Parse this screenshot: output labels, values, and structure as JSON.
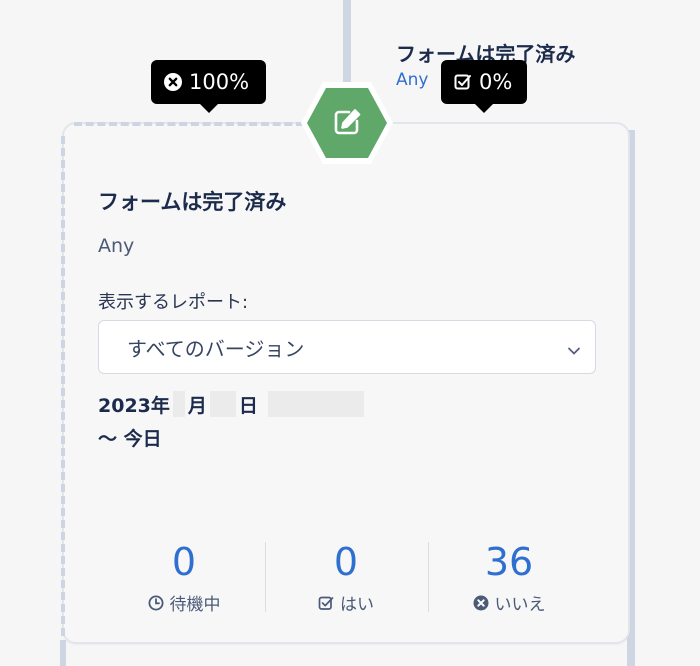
{
  "branch": {
    "title": "フォームは完了済み",
    "subtitle": "Any"
  },
  "tooltips": [
    {
      "icon": "x-circle-icon",
      "text": "100%"
    },
    {
      "icon": "checkbox-icon",
      "text": "0%"
    }
  ],
  "card": {
    "icon": "edit-icon",
    "title": "フォームは完了済み",
    "subtitle": "Any",
    "report_label": "表示するレポート:",
    "version_select": "すべてのバージョン",
    "date": {
      "year": "2023年",
      "month": "月",
      "day": "日",
      "until": "～ 今日"
    }
  },
  "stats": [
    {
      "value": "0",
      "label": "待機中",
      "icon": "clock-icon"
    },
    {
      "value": "0",
      "label": "はい",
      "icon": "checkbox-icon"
    },
    {
      "value": "36",
      "label": "いいえ",
      "icon": "x-circle-icon"
    }
  ],
  "colors": {
    "accent": "#2f6fcf",
    "hexagon": "#5fa869",
    "title": "#1c2b4b"
  }
}
